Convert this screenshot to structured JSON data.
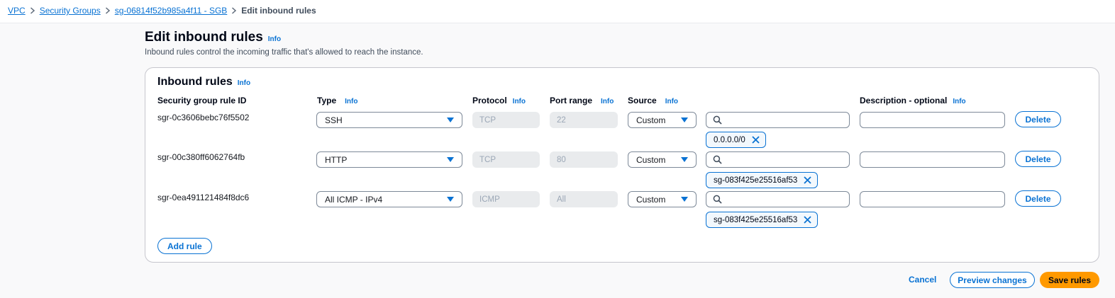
{
  "breadcrumb": {
    "items": [
      "VPC",
      "Security Groups",
      "sg-06814f52b985a4f11 - SGB"
    ],
    "current": "Edit inbound rules"
  },
  "page": {
    "title": "Edit inbound rules",
    "info": "Info",
    "description": "Inbound rules control the incoming traffic that's allowed to reach the instance."
  },
  "panel": {
    "title": "Inbound rules",
    "info": "Info",
    "columns": {
      "rule_id": "Security group rule ID",
      "type": "Type",
      "protocol": "Protocol",
      "port_range": "Port range",
      "source": "Source",
      "description": "Description - optional",
      "info": "Info"
    },
    "rules": [
      {
        "id": "sgr-0c3606bebc76f5502",
        "type": "SSH",
        "protocol": "TCP",
        "port_range": "22",
        "source": "Custom",
        "source_value": "",
        "token": "0.0.0.0/0",
        "description": "",
        "delete": "Delete"
      },
      {
        "id": "sgr-00c380ff6062764fb",
        "type": "HTTP",
        "protocol": "TCP",
        "port_range": "80",
        "source": "Custom",
        "source_value": "",
        "token": "sg-083f425e25516af53",
        "description": "",
        "delete": "Delete"
      },
      {
        "id": "sgr-0ea491121484f8dc6",
        "type": "All ICMP - IPv4",
        "protocol": "ICMP",
        "port_range": "All",
        "source": "Custom",
        "source_value": "",
        "token": "sg-083f425e25516af53",
        "description": "",
        "delete": "Delete"
      }
    ],
    "add_rule": "Add rule"
  },
  "footer": {
    "cancel": "Cancel",
    "preview": "Preview changes",
    "save": "Save rules"
  },
  "colors": {
    "link": "#0972d3",
    "primary_button": "#ff9900",
    "border": "#7d8998",
    "readonly_bg": "#e9ebed"
  },
  "icons": {
    "breadcrumb_separator": "chevron-right-icon",
    "select_caret": "caret-down-icon",
    "search": "search-icon",
    "token_dismiss": "close-icon"
  }
}
